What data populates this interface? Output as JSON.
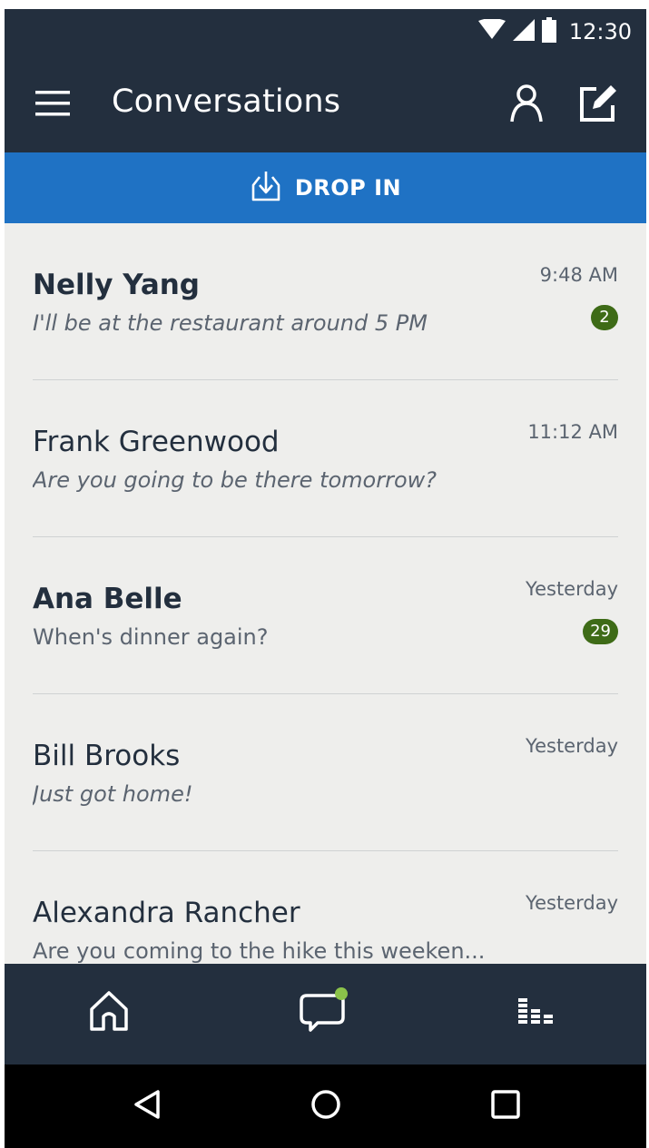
{
  "status_bar": {
    "time": "12:30",
    "icons": [
      "wifi-icon",
      "cell-signal-icon",
      "battery-icon"
    ]
  },
  "app_bar": {
    "title": "Conversations",
    "icons": [
      "menu-icon",
      "contacts-icon",
      "compose-icon"
    ]
  },
  "drop_in": {
    "label": "DROP IN",
    "icon": "drop-in-icon",
    "color": "#1f72c4"
  },
  "conversations": [
    {
      "name": "Nelly Yang",
      "preview": "I'll be at the restaurant around 5 PM",
      "time": "9:48 AM",
      "badge": "2",
      "unread": true,
      "italic_preview": true
    },
    {
      "name": "Frank Greenwood",
      "preview": "Are you going to be there tomorrow?",
      "time": "11:12 AM",
      "badge": "",
      "unread": false,
      "italic_preview": true
    },
    {
      "name": "Ana Belle",
      "preview": "When's dinner again?",
      "time": "Yesterday",
      "badge": "29",
      "unread": true,
      "italic_preview": false
    },
    {
      "name": "Bill Brooks",
      "preview": "Just got home!",
      "time": "Yesterday",
      "badge": "",
      "unread": false,
      "italic_preview": true
    },
    {
      "name": "Alexandra Rancher",
      "preview": "Are you coming to the hike this weeken...",
      "time": "Yesterday",
      "badge": "",
      "unread": false,
      "italic_preview": false
    }
  ],
  "bottom_nav": {
    "items": [
      "home-icon",
      "conversations-icon",
      "activity-icon"
    ],
    "active": "conversations-icon",
    "notification_dot_color": "#8bc34a"
  },
  "system_nav": {
    "items": [
      "back-icon",
      "home-circle-icon",
      "recents-icon"
    ]
  },
  "colors": {
    "header": "#232f3e",
    "accent": "#1f72c4",
    "badge": "#3e6b17",
    "list_background": "#eeeeec"
  }
}
